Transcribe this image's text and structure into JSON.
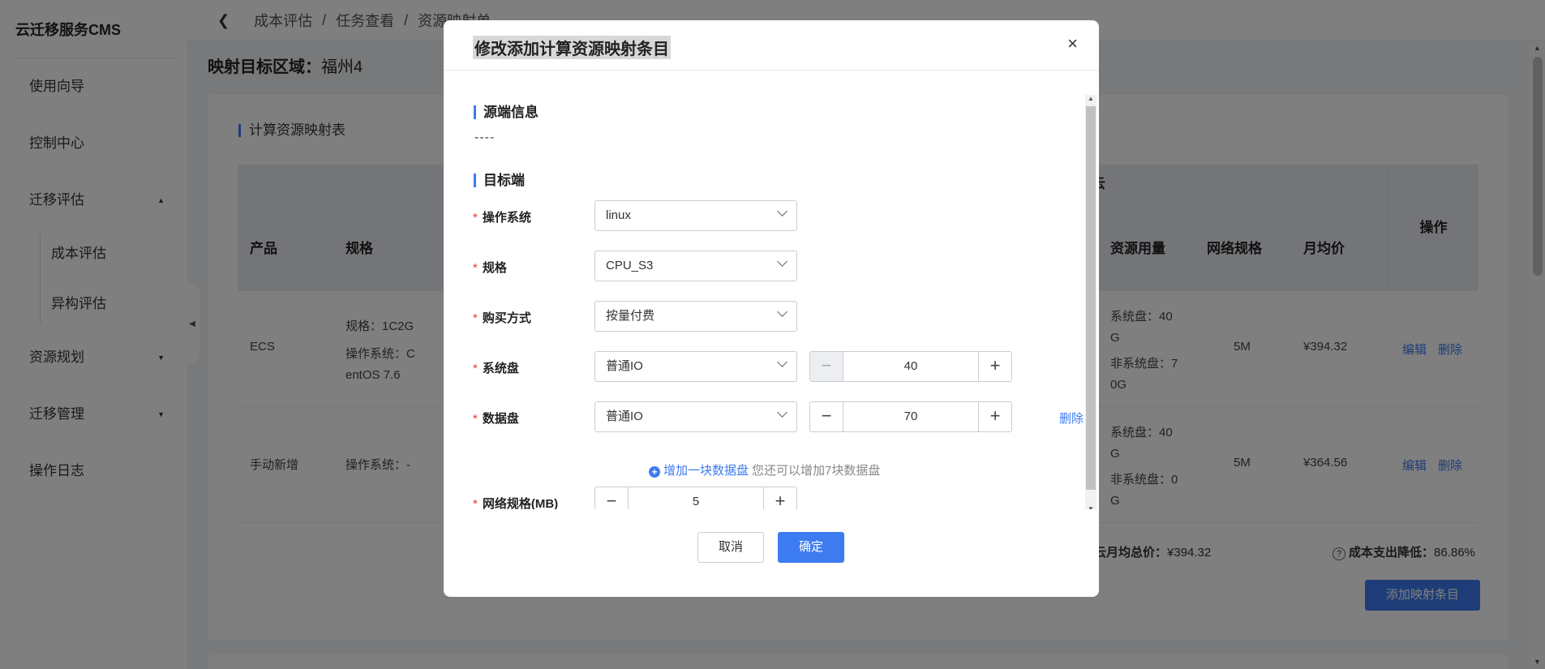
{
  "app": {
    "brand": "云迁移服务CMS"
  },
  "sidebar": {
    "items": [
      {
        "label": "使用向导"
      },
      {
        "label": "控制中心"
      },
      {
        "label": "迁移评估",
        "caret": "▲"
      },
      {
        "label": "成本评估"
      },
      {
        "label": "异构评估"
      },
      {
        "label": "资源规划",
        "caret": "▼"
      },
      {
        "label": "迁移管理",
        "caret": "▼"
      },
      {
        "label": "操作日志"
      }
    ]
  },
  "breadcrumb": {
    "back": "❮",
    "items": [
      "成本评估",
      "/",
      "任务查看",
      "/",
      "资源映射单"
    ]
  },
  "page": {
    "region_label": "映射目标区域：",
    "region_value": "福州4"
  },
  "table": {
    "title": "计算资源映射表",
    "group_header": "云",
    "headers": [
      "产品",
      "规格",
      "",
      "资源用量",
      "网络规格",
      "月均价",
      "操作"
    ],
    "rows": [
      {
        "product": "ECS",
        "spec_line1": "规格：1C2G",
        "spec_line2": "操作系统：C",
        "spec_line3": "entOS 7.6",
        "usage_line1": "系统盘：40",
        "usage_line2": "G",
        "usage_line3": "非系统盘：7",
        "usage_line4": "0G",
        "net": "5M",
        "price": "¥394.32",
        "edit": "编辑",
        "delete": "删除"
      },
      {
        "product": "手动新增",
        "spec_line1": "操作系统：-",
        "usage_line1": "系统盘：40",
        "usage_line2": "G",
        "usage_line3": "非系统盘：0",
        "usage_line4": "G",
        "net": "5M",
        "price": "¥364.56",
        "edit": "编辑",
        "delete": "删除"
      }
    ],
    "total_label": "云月均总价：",
    "total_value": "¥394.32",
    "saving_icon": "?",
    "saving_label": "成本支出降低：",
    "saving_value": "86.86%",
    "add_button": "添加映射条目"
  },
  "modal": {
    "title": "修改添加计算资源映射条目",
    "close": "×",
    "source_title": "源端信息",
    "source_value": "----",
    "target_title": "目标端",
    "fields": {
      "os": {
        "label": "操作系统",
        "value": "linux"
      },
      "spec": {
        "label": "规格",
        "value": "CPU_S3"
      },
      "purchase": {
        "label": "购买方式",
        "value": "按量付费"
      },
      "sysdisk": {
        "label": "系统盘",
        "type": "普通IO",
        "size": "40"
      },
      "datadisk": {
        "label": "数据盘",
        "type": "普通IO",
        "size": "70",
        "delete": "删除"
      },
      "network": {
        "label": "网络规格(MB)",
        "value": "5"
      }
    },
    "add_disk_link": "增加一块数据盘",
    "add_disk_hint": "您还可以增加7块数据盘",
    "cancel": "取消",
    "ok": "确定"
  },
  "symbols": {
    "required": "*",
    "minus": "−",
    "plus": "+"
  }
}
